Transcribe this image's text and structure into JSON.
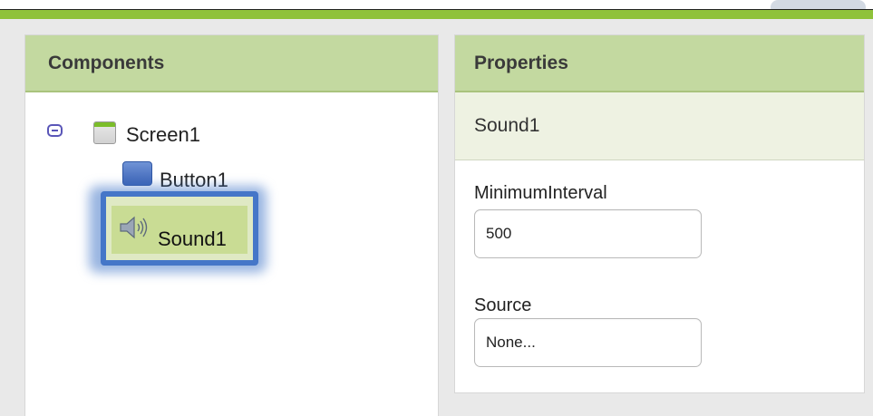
{
  "panels": {
    "components": {
      "title": "Components",
      "tree": {
        "root": {
          "label": "Screen1"
        },
        "children": [
          {
            "label": "Button1"
          },
          {
            "label": "Sound1",
            "selected": true
          }
        ]
      }
    },
    "properties": {
      "title": "Properties",
      "selected_component": "Sound1",
      "fields": [
        {
          "label": "MinimumInterval",
          "value": "500"
        },
        {
          "label": "Source",
          "value": "None..."
        }
      ]
    }
  },
  "colors": {
    "header_green": "#c3d9a0",
    "top_bar_green": "#8fc23a",
    "selection_blue": "#4576c8"
  },
  "icons": {
    "collapse": "collapse-minus-icon",
    "screen": "screen-icon",
    "button": "button-icon",
    "sound": "speaker-icon"
  }
}
